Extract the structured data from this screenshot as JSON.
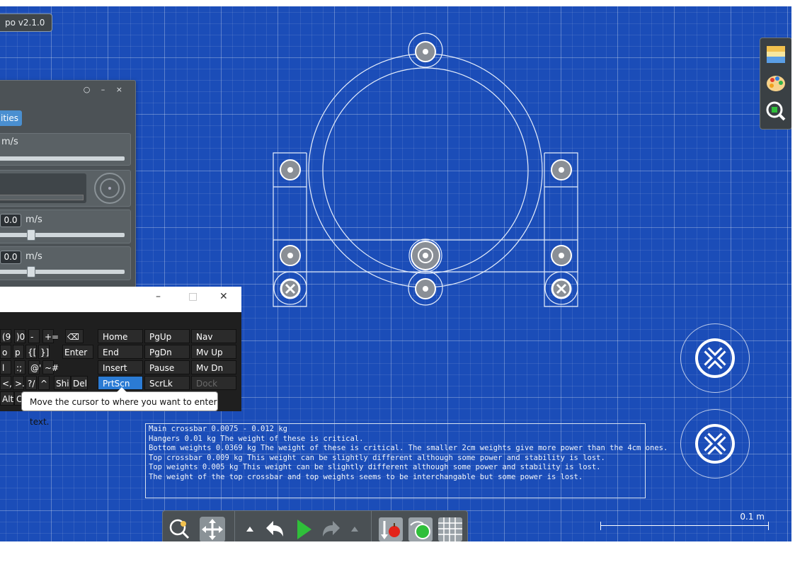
{
  "app": {
    "version_label": "po v2.1.0"
  },
  "panel": {
    "window_controls": "○ – ×",
    "tab_label": "ities",
    "rows": [
      {
        "unit": "m/s"
      },
      {
        "value": "0.0",
        "unit": "m/s",
        "slider_fraction": 0.26
      },
      {
        "value": "0.0",
        "unit": "m/s",
        "slider_fraction": 0.26
      }
    ]
  },
  "osk": {
    "minimize": "–",
    "maximize": "□",
    "close": "✕",
    "left_keys": [
      [
        "(9",
        ")0",
        "-",
        "+=",
        "⌫"
      ],
      [
        "o",
        "p",
        "{[",
        "}]",
        "Enter"
      ],
      [
        "l",
        ":;",
        "@'",
        "~#"
      ],
      [
        "<,",
        ">.",
        "?/",
        "^",
        "Shi",
        "Del"
      ],
      [
        "Alt",
        "C"
      ]
    ],
    "nav_keys": [
      [
        "Home",
        "PgUp",
        "Nav"
      ],
      [
        "End",
        "PgDn",
        "Mv Up"
      ],
      [
        "Insert",
        "Pause",
        "Mv Dn"
      ],
      [
        "PrtScn",
        "ScrLk",
        "Dock"
      ]
    ]
  },
  "tooltip": {
    "text": "Move the cursor to where you want to enter text."
  },
  "info_lines": [
    "Main crossbar 0.0075 - 0.012 kg",
    "Hangers 0.01 kg The weight of these is critical.",
    "Bottom weights 0.0369 kg The weight of these is critical. The smaller 2cm weights give more power than the 4cm ones.",
    "Top crossbar 0.009 kg This weight can be slightly different although some power and stability is lost.",
    "Top weights 0.005 kg This weight can be slightly different although some power and stability is lost.",
    "The weight of the top crossbar and top weights seems to be interchangable but some power is lost."
  ],
  "scale": {
    "label": "0.1 m"
  },
  "right_tools": [
    "layers-icon",
    "palette-icon",
    "zoom-to-fit-icon"
  ],
  "bottom_tools": [
    "zoom-icon",
    "move-icon",
    "up-arrow-icon",
    "undo-icon",
    "play-icon",
    "redo-icon",
    "up-arrow-icon",
    "gravity-apple-icon",
    "physics-settings-icon",
    "grid-icon"
  ],
  "colors": {
    "background": "#1b4db8",
    "accent": "#2b7bd4",
    "play": "#2fbf3a"
  }
}
